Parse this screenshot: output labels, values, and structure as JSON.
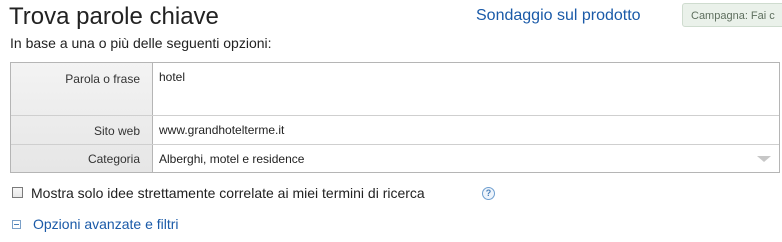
{
  "header": {
    "title": "Trova parole chiave",
    "survey_link": "Sondaggio sul prodotto",
    "campaign_label": "Campagna: Fai c"
  },
  "subtitle": "In base a una o più delle seguenti opzioni:",
  "form": {
    "keyword_label": "Parola o frase",
    "keyword_value": "hotel",
    "site_label": "Sito web",
    "site_value": "www.grandhotelterme.it",
    "category_label": "Categoria",
    "category_value": "Alberghi, motel e residence"
  },
  "options": {
    "strict_checkbox_label": "Mostra solo idee strettamente correlate ai miei termini di ricerca",
    "strict_checked": false,
    "help_glyph": "?",
    "advanced_link": "Opzioni avanzate e filtri"
  },
  "colors": {
    "link": "#1a5aa8",
    "campaign_bg": "#eaf1ea"
  },
  "icons": {
    "help": "help-icon",
    "collapse": "collapse-minus-icon",
    "dropdown": "chevron-down-icon"
  }
}
